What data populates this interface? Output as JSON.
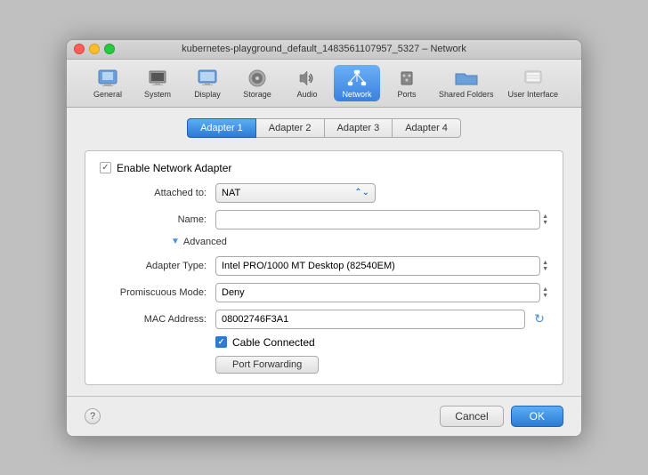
{
  "window": {
    "title": "kubernetes-playground_default_1483561107957_5327 – Network"
  },
  "toolbar": {
    "items": [
      {
        "id": "general",
        "label": "General",
        "icon": "⚙"
      },
      {
        "id": "system",
        "label": "System",
        "icon": "🖥"
      },
      {
        "id": "display",
        "label": "Display",
        "icon": "🖥"
      },
      {
        "id": "storage",
        "label": "Storage",
        "icon": "💿"
      },
      {
        "id": "audio",
        "label": "Audio",
        "icon": "🔊"
      },
      {
        "id": "network",
        "label": "Network",
        "icon": "🌐",
        "active": true
      },
      {
        "id": "ports",
        "label": "Ports",
        "icon": "🔌"
      },
      {
        "id": "shared-folders",
        "label": "Shared Folders",
        "icon": "📁"
      },
      {
        "id": "user-interface",
        "label": "User Interface",
        "icon": "🖱"
      }
    ]
  },
  "tabs": [
    {
      "id": "adapter1",
      "label": "Adapter 1",
      "active": true
    },
    {
      "id": "adapter2",
      "label": "Adapter 2"
    },
    {
      "id": "adapter3",
      "label": "Adapter 3"
    },
    {
      "id": "adapter4",
      "label": "Adapter 4"
    }
  ],
  "form": {
    "enable_label": "Enable Network Adapter",
    "enable_checked": true,
    "attached_to_label": "Attached to:",
    "attached_to_value": "NAT",
    "name_label": "Name:",
    "name_value": "",
    "advanced_label": "Advanced",
    "adapter_type_label": "Adapter Type:",
    "adapter_type_value": "Intel PRO/1000 MT Desktop (82540EM)",
    "promiscuous_label": "Promiscuous Mode:",
    "promiscuous_value": "Deny",
    "mac_label": "MAC Address:",
    "mac_value": "08002746F3A1",
    "cable_connected_label": "Cable Connected",
    "port_forwarding_label": "Port Forwarding"
  },
  "footer": {
    "help_label": "?",
    "cancel_label": "Cancel",
    "ok_label": "OK"
  }
}
